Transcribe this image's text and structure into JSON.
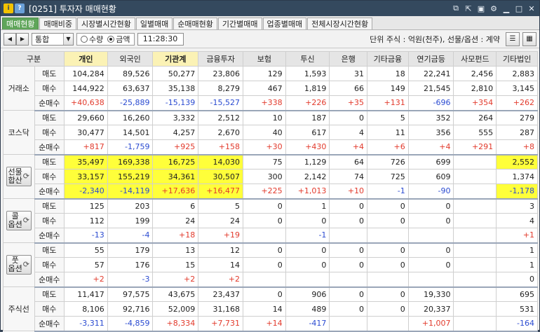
{
  "window": {
    "title": "[0251] 투자자 매매현황",
    "icon_a": "i",
    "icon_b": "?"
  },
  "tabs": [
    "매매현황",
    "매매비중",
    "시장별시간현황",
    "일별매매",
    "순매매현황",
    "기간별매매",
    "업종별매매",
    "전체시장시간현황"
  ],
  "toolbar": {
    "combo_value": "통합",
    "radio_qty": "수량",
    "radio_amt": "금액",
    "time": "11:28:30",
    "unit_text": "단위 주식 : 억원(천주), 선물/옵션 : 계약"
  },
  "header": [
    "구분",
    "개인",
    "외국인",
    "기관계",
    "금융투자",
    "보험",
    "투신",
    "은행",
    "기타금융",
    "연기금등",
    "사모펀드",
    "기타법인"
  ],
  "row_labels": [
    "매도",
    "매수",
    "순매수"
  ],
  "colors": {
    "positive": "#e23a2c",
    "negative": "#2b4bd1",
    "highlight": "#ffff3a",
    "active_tab": "#5fa55a"
  },
  "markets": [
    {
      "name": "거래소",
      "rows": [
        [
          "104,284",
          "89,526",
          "50,277",
          "23,806",
          "129",
          "1,593",
          "31",
          "18",
          "22,241",
          "2,456",
          "2,883"
        ],
        [
          "144,922",
          "63,637",
          "35,138",
          "8,279",
          "467",
          "1,819",
          "66",
          "149",
          "21,545",
          "2,810",
          "3,145"
        ],
        [
          "+40,638",
          "-25,889",
          "-15,139",
          "-15,527",
          "+338",
          "+226",
          "+35",
          "+131",
          "-696",
          "+354",
          "+262"
        ]
      ]
    },
    {
      "name": "코스닥",
      "rows": [
        [
          "29,660",
          "16,260",
          "3,332",
          "2,512",
          "10",
          "187",
          "0",
          "5",
          "352",
          "264",
          "279"
        ],
        [
          "30,477",
          "14,501",
          "4,257",
          "2,670",
          "40",
          "617",
          "4",
          "11",
          "356",
          "555",
          "287"
        ],
        [
          "+817",
          "-1,759",
          "+925",
          "+158",
          "+30",
          "+430",
          "+4",
          "+6",
          "+4",
          "+291",
          "+8"
        ]
      ]
    },
    {
      "name": "선물\n합산",
      "button": true,
      "rows": [
        [
          "35,497",
          "169,338",
          "16,725",
          "14,030",
          "75",
          "1,129",
          "64",
          "726",
          "699",
          "",
          "2,552"
        ],
        [
          "33,157",
          "155,219",
          "34,361",
          "30,507",
          "300",
          "2,142",
          "74",
          "725",
          "609",
          "",
          "1,374"
        ],
        [
          "-2,340",
          "-14,119",
          "+17,636",
          "+16,477",
          "+225",
          "+1,013",
          "+10",
          "-1",
          "-90",
          "",
          "-1,178"
        ]
      ]
    },
    {
      "name": "콜\n옵션",
      "button": true,
      "rows": [
        [
          "125",
          "203",
          "6",
          "5",
          "0",
          "1",
          "0",
          "0",
          "0",
          "",
          "3"
        ],
        [
          "112",
          "199",
          "24",
          "24",
          "0",
          "0",
          "0",
          "0",
          "0",
          "",
          "4"
        ],
        [
          "-13",
          "-4",
          "+18",
          "+19",
          "",
          "-1",
          "",
          "",
          "",
          "",
          "+1"
        ]
      ]
    },
    {
      "name": "풋\n옵션",
      "button": true,
      "rows": [
        [
          "55",
          "179",
          "13",
          "12",
          "0",
          "0",
          "0",
          "0",
          "0",
          "",
          "1"
        ],
        [
          "57",
          "176",
          "15",
          "14",
          "0",
          "0",
          "0",
          "0",
          "0",
          "",
          "1"
        ],
        [
          "+2",
          "-3",
          "+2",
          "+2",
          "",
          "",
          "",
          "",
          "",
          "",
          "0"
        ]
      ]
    },
    {
      "name": "주식선",
      "rows": [
        [
          "11,417",
          "97,575",
          "43,675",
          "23,437",
          "0",
          "906",
          "0",
          "0",
          "19,330",
          "",
          "695"
        ],
        [
          "8,106",
          "92,716",
          "52,009",
          "31,168",
          "14",
          "489",
          "0",
          "0",
          "20,337",
          "",
          "531"
        ],
        [
          "-3,311",
          "-4,859",
          "+8,334",
          "+7,731",
          "+14",
          "-417",
          "",
          "",
          "+1,007",
          "",
          "-164"
        ]
      ]
    }
  ],
  "highlight_cells": {
    "2": [
      [
        0,
        0
      ],
      [
        0,
        1
      ],
      [
        0,
        2
      ],
      [
        0,
        3
      ],
      [
        0,
        10
      ],
      [
        1,
        0
      ],
      [
        1,
        1
      ],
      [
        1,
        2
      ],
      [
        1,
        3
      ],
      [
        2,
        0
      ],
      [
        2,
        1
      ],
      [
        2,
        2
      ],
      [
        2,
        3
      ],
      [
        2,
        10
      ]
    ]
  },
  "header_highlight": [
    1,
    3
  ]
}
